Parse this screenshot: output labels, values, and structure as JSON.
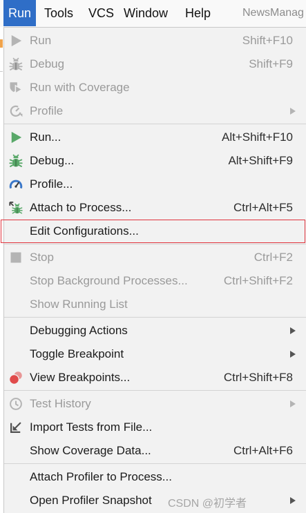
{
  "menubar": {
    "items": [
      {
        "label": "Run",
        "active": true
      },
      {
        "label": "Tools"
      },
      {
        "label": "VCS"
      },
      {
        "label": "Window"
      },
      {
        "label": "Help"
      }
    ],
    "project_name": "NewsManag"
  },
  "run_menu": {
    "groups": [
      {
        "items": [
          {
            "label": "Run",
            "shortcut": "Shift+F10",
            "icon": "play-icon",
            "enabled": false
          },
          {
            "label": "Debug",
            "shortcut": "Shift+F9",
            "icon": "bug-icon",
            "enabled": false
          },
          {
            "label": "Run with Coverage",
            "icon": "coverage-icon",
            "enabled": false
          },
          {
            "label": "Profile",
            "icon": "profile-icon",
            "enabled": false,
            "has_submenu": true
          }
        ]
      },
      {
        "items": [
          {
            "label": "Run...",
            "shortcut": "Alt+Shift+F10",
            "icon": "play-icon",
            "enabled": true
          },
          {
            "label": "Debug...",
            "shortcut": "Alt+Shift+F9",
            "icon": "bug-icon",
            "enabled": true
          },
          {
            "label": "Profile...",
            "icon": "gauge-icon",
            "enabled": true
          },
          {
            "label": "Attach to Process...",
            "shortcut": "Ctrl+Alt+F5",
            "icon": "attach-debugger-icon",
            "enabled": true
          },
          {
            "label": "Edit Configurations...",
            "enabled": true,
            "highlighted": true
          }
        ]
      },
      {
        "items": [
          {
            "label": "Stop",
            "shortcut": "Ctrl+F2",
            "icon": "stop-icon",
            "enabled": false
          },
          {
            "label": "Stop Background Processes...",
            "shortcut": "Ctrl+Shift+F2",
            "enabled": false
          },
          {
            "label": "Show Running List",
            "enabled": false
          }
        ]
      },
      {
        "items": [
          {
            "label": "Debugging Actions",
            "enabled": true,
            "has_submenu": true
          },
          {
            "label": "Toggle Breakpoint",
            "enabled": true,
            "has_submenu": true
          },
          {
            "label": "View Breakpoints...",
            "shortcut": "Ctrl+Shift+F8",
            "icon": "breakpoints-icon",
            "enabled": true
          }
        ]
      },
      {
        "items": [
          {
            "label": "Test History",
            "icon": "clock-icon",
            "enabled": false,
            "has_submenu": true
          },
          {
            "label": "Import Tests from File...",
            "icon": "import-icon",
            "enabled": true
          },
          {
            "label": "Show Coverage Data...",
            "shortcut": "Ctrl+Alt+F6",
            "enabled": true
          }
        ]
      },
      {
        "items": [
          {
            "label": "Attach Profiler to Process...",
            "enabled": true
          },
          {
            "label": "Open Profiler Snapshot",
            "enabled": true,
            "has_submenu": true
          }
        ]
      }
    ]
  },
  "colors": {
    "menubar_active_bg": "#2f6ec7",
    "highlight_border": "#e0323c",
    "run_green": "#59a869",
    "profile_blue": "#3a77c8",
    "breakpoint_red": "#e04b4b"
  },
  "watermark": "CSDN @初学者"
}
